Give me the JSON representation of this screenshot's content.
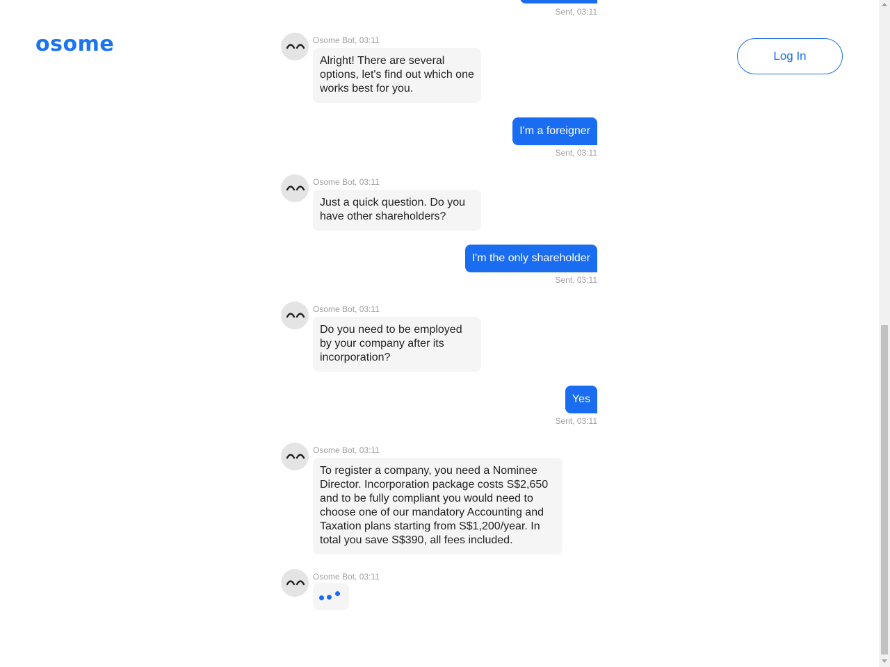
{
  "header": {
    "logo": "osome",
    "login_label": "Log In"
  },
  "chat": {
    "top_sent_meta": "Sent, 03:11",
    "messages": [
      {
        "from": "bot",
        "meta": "Osome Bot, 03:11",
        "text": "Alright! There are several options, let's find out which one works best for you."
      },
      {
        "from": "user",
        "text": "I'm a foreigner",
        "meta": "Sent, 03:11"
      },
      {
        "from": "bot",
        "meta": "Osome Bot, 03:11",
        "text": "Just a quick question. Do you have other shareholders?"
      },
      {
        "from": "user",
        "text": "I'm the only shareholder",
        "meta": "Sent, 03:11"
      },
      {
        "from": "bot",
        "meta": "Osome Bot, 03:11",
        "text": "Do you need to be employed by your company after its incorporation?"
      },
      {
        "from": "user",
        "text": "Yes",
        "meta": "Sent, 03:11"
      },
      {
        "from": "bot",
        "meta": "Osome Bot, 03:11",
        "text": "To register a company, you need a Nominee Director. Incorporation package costs S$2,650 and to be fully compliant you would need to choose one of our mandatory Accounting and Taxation plans starting from S$1,200/year. In total you save S$390, all fees included."
      },
      {
        "from": "bot",
        "meta": "Osome Bot, 03:11",
        "typing": true
      }
    ]
  },
  "colors": {
    "accent": "#1a6cf0",
    "bot_bubble": "#f5f5f5",
    "meta_text": "#9e9e9e"
  },
  "icons": {
    "avatar": "sleepy-face-icon",
    "typing": "typing-dots-icon"
  }
}
